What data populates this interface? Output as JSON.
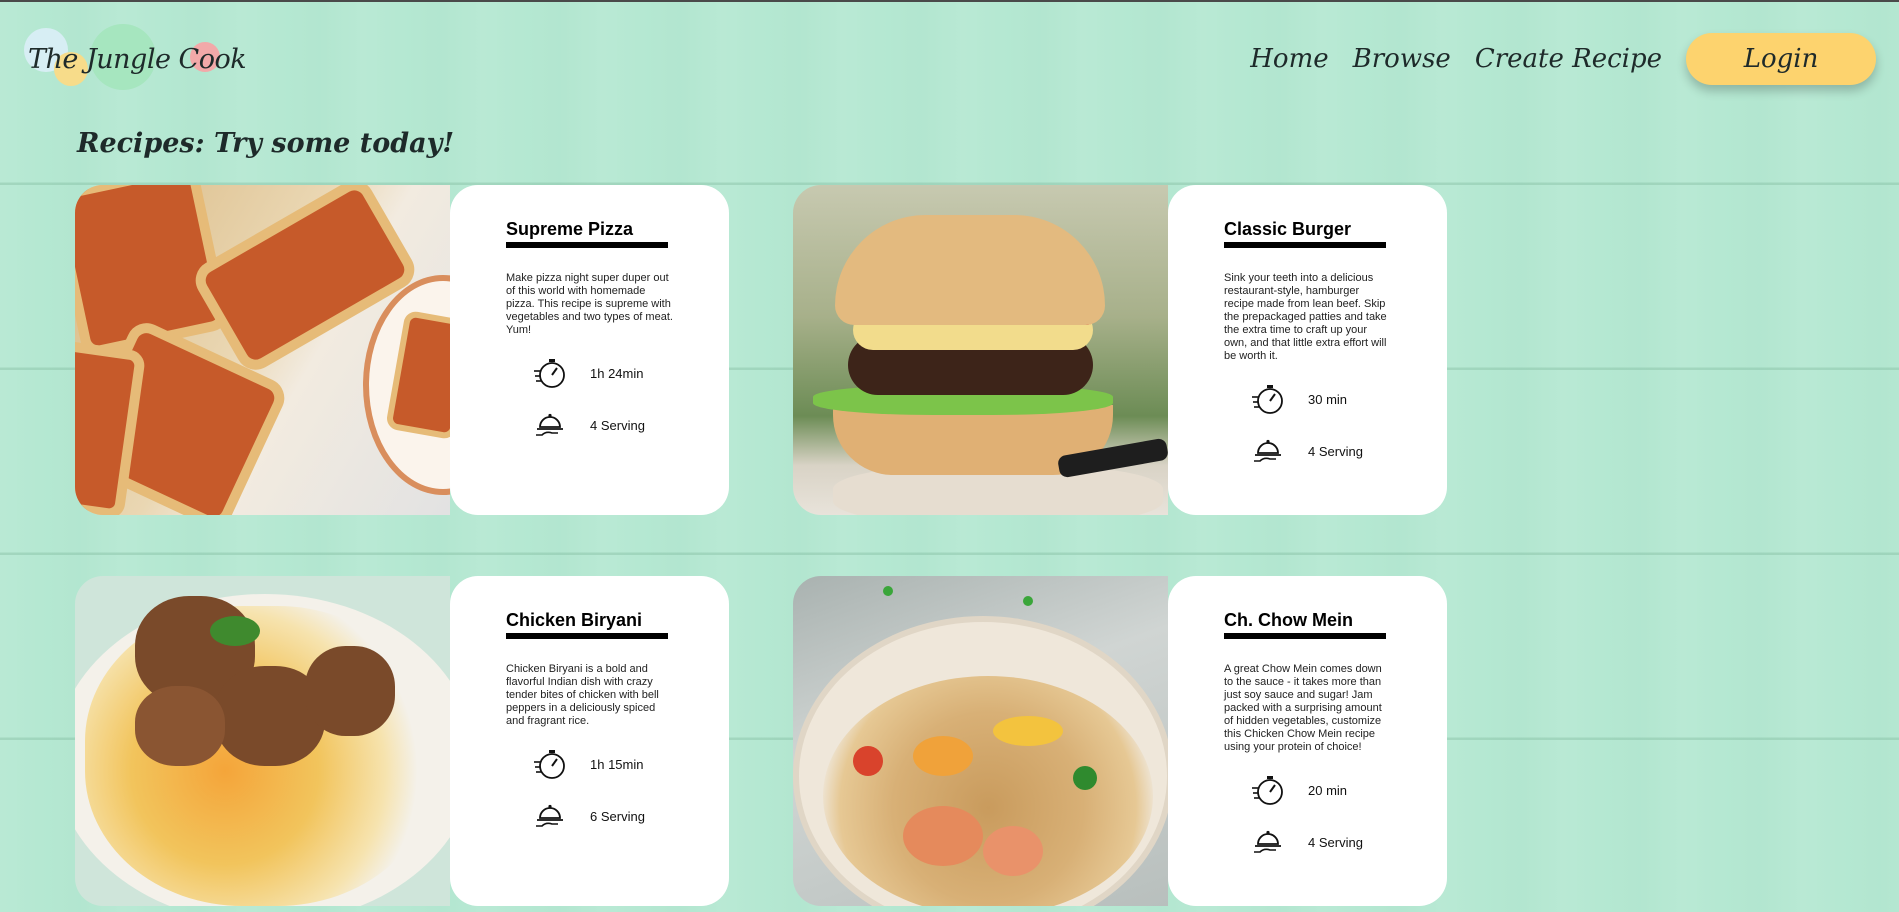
{
  "header": {
    "logo_text": "The Jungle Cook",
    "nav": [
      "Home",
      "Browse",
      "Create Recipe"
    ],
    "login_label": "Login"
  },
  "page_title": "Recipes: Try some today!",
  "icons": {
    "time": "stopwatch-icon",
    "serving": "serving-cloche-icon"
  },
  "recipes": [
    {
      "name": "Supreme Pizza",
      "description": "Make pizza night super duper out of this world with homemade pizza. This recipe is supreme with vegetables and two types of meat. Yum!",
      "time": "1h 24min",
      "servings": "4 Serving",
      "image_alt": "pizza-photo"
    },
    {
      "name": "Classic Burger",
      "description": "Sink your teeth into a delicious restaurant-style, hamburger recipe made from lean beef. Skip the prepackaged patties and take the extra time to craft up your own, and that little extra effort will be worth it.",
      "time": "30 min",
      "servings": "4 Serving",
      "image_alt": "burger-photo"
    },
    {
      "name": "Chicken Biryani",
      "description": "Chicken Biryani is a bold and flavorful Indian dish with crazy tender bites of chicken with bell peppers in a deliciously spiced and fragrant rice.",
      "time": "1h 15min",
      "servings": "6 Serving",
      "image_alt": "biryani-photo"
    },
    {
      "name": "Ch. Chow Mein",
      "description": "A great Chow Mein comes down to the sauce - it takes more than just soy sauce and sugar! Jam packed with a surprising amount of hidden vegetables, customize this Chicken Chow Mein recipe using your protein of choice!",
      "time": "20 min",
      "servings": "4 Serving",
      "image_alt": "chow-mein-photo"
    }
  ]
}
